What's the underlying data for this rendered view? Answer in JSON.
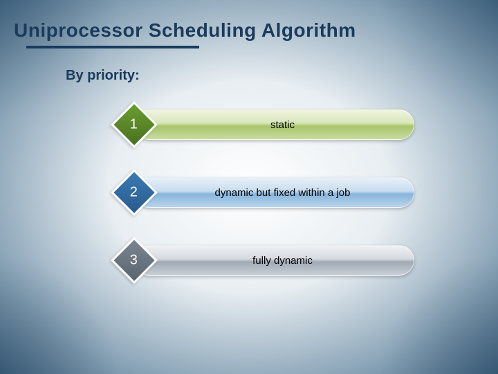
{
  "title": "Uniprocessor Scheduling Algorithm",
  "subtitle": "By priority:",
  "items": [
    {
      "num": "1",
      "label": "static"
    },
    {
      "num": "2",
      "label": "dynamic but fixed within a job"
    },
    {
      "num": "3",
      "label": "fully dynamic"
    }
  ]
}
